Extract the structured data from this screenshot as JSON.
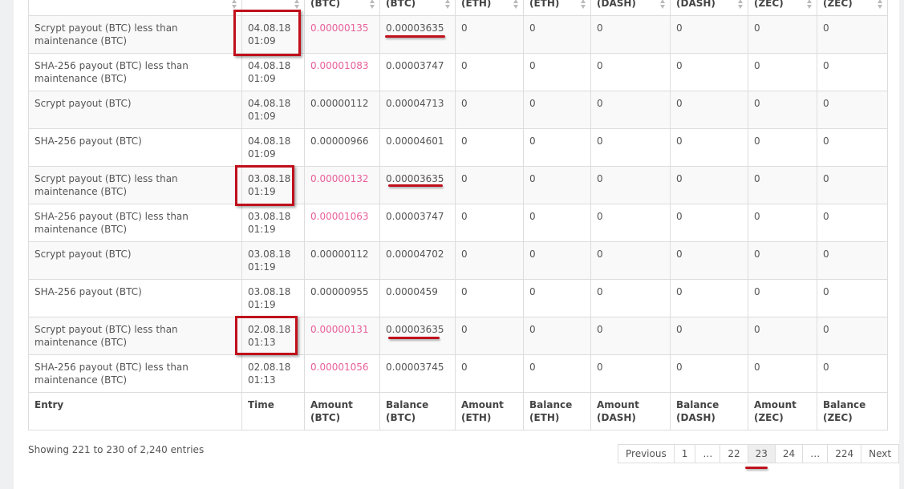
{
  "table": {
    "header_top": [
      "(BTC)",
      "(BTC)",
      "(ETH)",
      "(ETH)",
      "(DASH)",
      "(DASH)",
      "(ZEC)",
      "(ZEC)"
    ],
    "footer": [
      {
        "line1": "Entry",
        "line2": ""
      },
      {
        "line1": "Time",
        "line2": ""
      },
      {
        "line1": "Amount",
        "line2": "(BTC)"
      },
      {
        "line1": "Balance",
        "line2": "(BTC)"
      },
      {
        "line1": "Amount",
        "line2": "(ETH)"
      },
      {
        "line1": "Balance",
        "line2": "(ETH)"
      },
      {
        "line1": "Amount",
        "line2": "(DASH)"
      },
      {
        "line1": "Balance",
        "line2": "(DASH)"
      },
      {
        "line1": "Amount",
        "line2": "(ZEC)"
      },
      {
        "line1": "Balance",
        "line2": "(ZEC)"
      }
    ],
    "rows": [
      {
        "entry": "Scrypt payout (BTC) less than maintenance (BTC)",
        "date": "04.08.18",
        "time": "01:09",
        "amount_btc": "0.00000135",
        "balance_btc": "0.00003635",
        "amount_eth": "0",
        "balance_eth": "0",
        "amount_dash": "0",
        "balance_dash": "0",
        "amount_zec": "0",
        "balance_zec": "0"
      },
      {
        "entry": "SHA-256 payout (BTC) less than maintenance (BTC)",
        "date": "04.08.18",
        "time": "01:09",
        "amount_btc": "0.00001083",
        "balance_btc": "0.00003747",
        "amount_eth": "0",
        "balance_eth": "0",
        "amount_dash": "0",
        "balance_dash": "0",
        "amount_zec": "0",
        "balance_zec": "0"
      },
      {
        "entry": "Scrypt payout (BTC)",
        "date": "04.08.18",
        "time": "01:09",
        "amount_btc": "0.00000112",
        "balance_btc": "0.00004713",
        "amount_eth": "0",
        "balance_eth": "0",
        "amount_dash": "0",
        "balance_dash": "0",
        "amount_zec": "0",
        "balance_zec": "0"
      },
      {
        "entry": "SHA-256 payout (BTC)",
        "date": "04.08.18",
        "time": "01:09",
        "amount_btc": "0.00000966",
        "balance_btc": "0.00004601",
        "amount_eth": "0",
        "balance_eth": "0",
        "amount_dash": "0",
        "balance_dash": "0",
        "amount_zec": "0",
        "balance_zec": "0"
      },
      {
        "entry": "Scrypt payout (BTC) less than maintenance (BTC)",
        "date": "03.08.18",
        "time": "01:19",
        "amount_btc": "0.00000132",
        "balance_btc": "0.00003635",
        "amount_eth": "0",
        "balance_eth": "0",
        "amount_dash": "0",
        "balance_dash": "0",
        "amount_zec": "0",
        "balance_zec": "0"
      },
      {
        "entry": "SHA-256 payout (BTC) less than maintenance (BTC)",
        "date": "03.08.18",
        "time": "01:19",
        "amount_btc": "0.00001063",
        "balance_btc": "0.00003747",
        "amount_eth": "0",
        "balance_eth": "0",
        "amount_dash": "0",
        "balance_dash": "0",
        "amount_zec": "0",
        "balance_zec": "0"
      },
      {
        "entry": "Scrypt payout (BTC)",
        "date": "03.08.18",
        "time": "01:19",
        "amount_btc": "0.00000112",
        "balance_btc": "0.00004702",
        "amount_eth": "0",
        "balance_eth": "0",
        "amount_dash": "0",
        "balance_dash": "0",
        "amount_zec": "0",
        "balance_zec": "0"
      },
      {
        "entry": "SHA-256 payout (BTC)",
        "date": "03.08.18",
        "time": "01:19",
        "amount_btc": "0.00000955",
        "balance_btc": "0.0000459",
        "amount_eth": "0",
        "balance_eth": "0",
        "amount_dash": "0",
        "balance_dash": "0",
        "amount_zec": "0",
        "balance_zec": "0"
      },
      {
        "entry": "Scrypt payout (BTC) less than maintenance (BTC)",
        "date": "02.08.18",
        "time": "01:13",
        "amount_btc": "0.00000131",
        "balance_btc": "0.00003635",
        "amount_eth": "0",
        "balance_eth": "0",
        "amount_dash": "0",
        "balance_dash": "0",
        "amount_zec": "0",
        "balance_zec": "0"
      },
      {
        "entry": "SHA-256 payout (BTC) less than maintenance (BTC)",
        "date": "02.08.18",
        "time": "01:13",
        "amount_btc": "0.00001056",
        "balance_btc": "0.00003745",
        "amount_eth": "0",
        "balance_eth": "0",
        "amount_dash": "0",
        "balance_dash": "0",
        "amount_zec": "0",
        "balance_zec": "0"
      }
    ]
  },
  "info_text": "Showing 221 to 230 of 2,240 entries",
  "pagination": {
    "items": [
      "Previous",
      "1",
      "…",
      "22",
      "23",
      "24",
      "…",
      "224",
      "Next"
    ],
    "active": "23"
  },
  "colors": {
    "highlight_amount": "#e8609a",
    "annotation": "#c0101c"
  }
}
